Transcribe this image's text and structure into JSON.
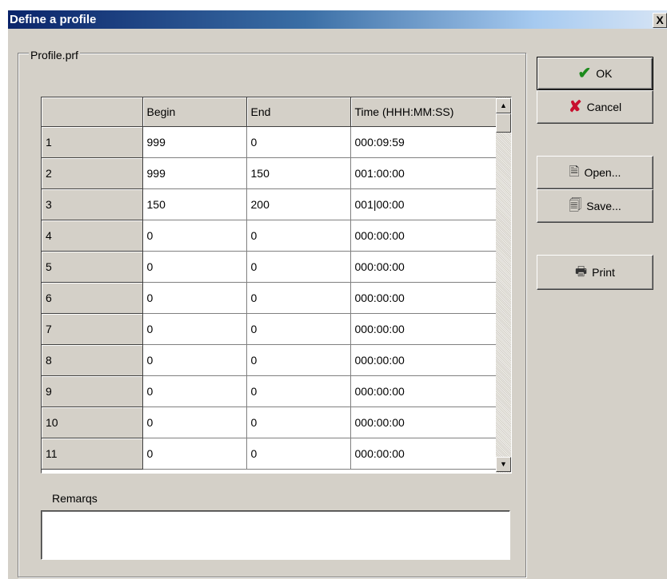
{
  "window": {
    "title": "Define a profile",
    "close_label": "X"
  },
  "group": {
    "label": "Profile.prf"
  },
  "grid": {
    "headers": [
      "",
      "Begin",
      "End",
      "Time (HHH:MM:SS)"
    ],
    "rows": [
      [
        "1",
        "999",
        "0",
        "000:09:59"
      ],
      [
        "2",
        "999",
        "150",
        "001:00:00"
      ],
      [
        "3",
        "150",
        "200",
        "001|00:00"
      ],
      [
        "4",
        "0",
        "0",
        "000:00:00"
      ],
      [
        "5",
        "0",
        "0",
        "000:00:00"
      ],
      [
        "6",
        "0",
        "0",
        "000:00:00"
      ],
      [
        "7",
        "0",
        "0",
        "000:00:00"
      ],
      [
        "8",
        "0",
        "0",
        "000:00:00"
      ],
      [
        "9",
        "0",
        "0",
        "000:00:00"
      ],
      [
        "10",
        "0",
        "0",
        "000:00:00"
      ],
      [
        "11",
        "0",
        "0",
        "000:00:00"
      ]
    ],
    "scroll_up_glyph": "▲",
    "scroll_down_glyph": "▼"
  },
  "remarks": {
    "label": "Remarqs",
    "value": ""
  },
  "buttons": {
    "ok": {
      "label": "OK",
      "icon": "check-icon",
      "glyph": "✔"
    },
    "cancel": {
      "label": "Cancel",
      "icon": "cross-icon",
      "glyph": "✘"
    },
    "open": {
      "label": "Open...",
      "icon": "open-file-icon",
      "glyph": "🗎"
    },
    "save": {
      "label": "Save...",
      "icon": "save-file-icon",
      "glyph": "🗐"
    },
    "print": {
      "label": "Print",
      "icon": "printer-icon",
      "glyph": "🖶"
    }
  },
  "colors": {
    "titlebar_start": "#0a246a",
    "dialog_face": "#d4d0c8",
    "ok_green": "#1c8a1c",
    "cancel_red": "#c8102e"
  }
}
